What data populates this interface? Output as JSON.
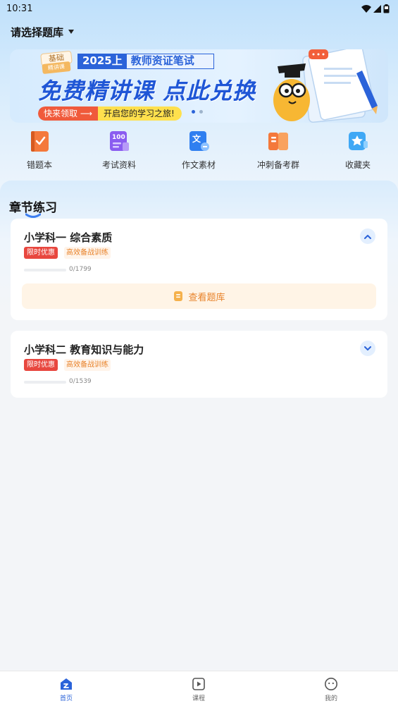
{
  "status_bar": {
    "time": "10:31"
  },
  "header": {
    "bank_selector_label": "请选择题库"
  },
  "banner": {
    "badge_top": "基础",
    "badge_bottom": "精讲课",
    "year": "2025上",
    "exam": "教师资证笔试",
    "headline": "免费精讲课 点此兑换",
    "cta_left": "快来领取 ⟶",
    "cta_right": "开启您的学习之旅!",
    "carousel_index": 1,
    "carousel_total": 2
  },
  "quick_links": [
    {
      "label": "错题本",
      "icon": "wrong-book-icon",
      "color": "#f4793b"
    },
    {
      "label": "考试资料",
      "icon": "exam-material-icon",
      "color": "#8a5cf0"
    },
    {
      "label": "作文素材",
      "icon": "essay-material-icon",
      "color": "#2f7ff0"
    },
    {
      "label": "冲刺备考群",
      "icon": "sprint-group-icon",
      "color": "#f4793b"
    },
    {
      "label": "收藏夹",
      "icon": "favorites-icon",
      "color": "#3fa8f5"
    }
  ],
  "section": {
    "title": "章节练习"
  },
  "subjects": [
    {
      "title": "小学科一 综合素质",
      "tag_promo": "限时优惠",
      "tag_feature": "高效备战训练",
      "progress_text": "0/1799",
      "progress": 0,
      "expanded": true,
      "view_button": "查看题库"
    },
    {
      "title": "小学科二 教育知识与能力",
      "tag_promo": "限时优惠",
      "tag_feature": "高效备战训练",
      "progress_text": "0/1539",
      "progress": 0,
      "expanded": false
    }
  ],
  "tabbar": {
    "items": [
      {
        "label": "首页",
        "icon": "home-icon",
        "active": true
      },
      {
        "label": "课程",
        "icon": "course-play-icon",
        "active": false
      },
      {
        "label": "我的",
        "icon": "profile-icon",
        "active": false
      }
    ]
  },
  "colors": {
    "accent": "#2b63d9",
    "promo_red": "#e8473f",
    "feature_orange": "#e8832b"
  }
}
